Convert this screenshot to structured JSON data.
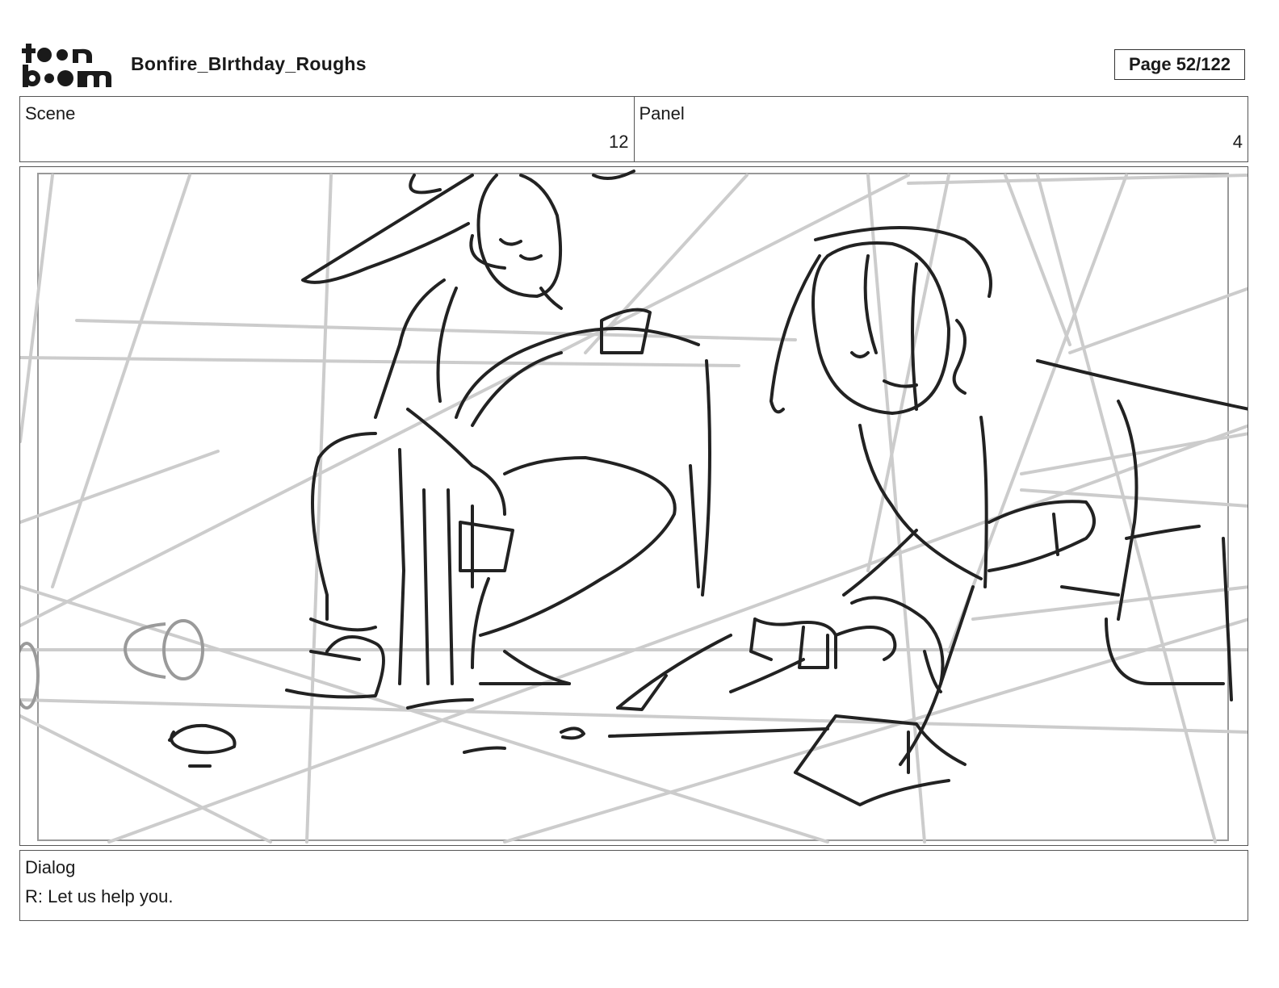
{
  "logo": {
    "icon": "toonboom-logo",
    "top_line": "toon",
    "bottom_line": "boom"
  },
  "header": {
    "project_title": "Bonfire_BIrthday_Roughs",
    "page_label": "Page  52/122"
  },
  "scene": {
    "label": "Scene",
    "value": "12"
  },
  "panel": {
    "label": "Panel",
    "value": "4"
  },
  "drawing": {
    "description_icon": "storyboard-sketch",
    "stroke_color": "#222222",
    "guide_color": "#c8c8c8"
  },
  "dialog": {
    "label": "Dialog",
    "text": "R: Let us help you."
  }
}
